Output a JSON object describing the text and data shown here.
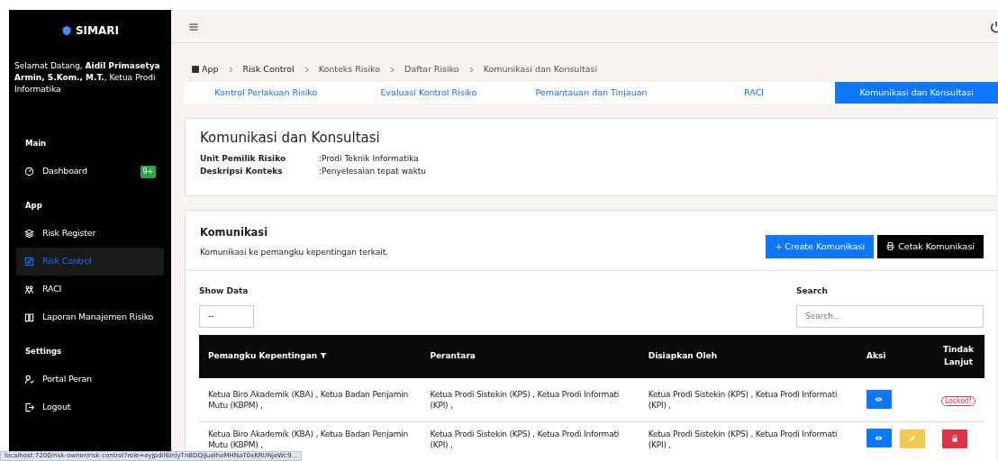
{
  "sidebar": {
    "brand": "SIMARI",
    "welcome": "Selamat Datang, **Aidil Primasetya Armin, S.Kom., M.T.**, Ketua Prodi Informatika",
    "sections": [
      {
        "title": "Main",
        "items": [
          {
            "label": "Dashboard",
            "selected": false,
            "badge": "9+"
          }
        ]
      },
      {
        "title": "App",
        "items": [
          {
            "label": "Risk Register",
            "selected": false
          },
          {
            "label": "Risk Control",
            "selected": true
          },
          {
            "label": "RACI",
            "selected": false
          },
          {
            "label": "Laporan Manajemen Risiko",
            "selected": false
          }
        ]
      },
      {
        "title": "Settings",
        "items": [
          {
            "label": "Portal Peran",
            "selected": false
          },
          {
            "label": "Logout",
            "selected": false
          }
        ]
      }
    ]
  },
  "breadcrumb": [
    {
      "label": "App"
    },
    {
      "label": "Risk Control"
    },
    {
      "label": "Konteks Risiko"
    },
    {
      "label": "Daftar Risiko"
    },
    {
      "label": "Komunikasi dan Konsultasi"
    }
  ],
  "tabs": [
    {
      "label": "Kontrol Perlakuan Risiko",
      "selected": false
    },
    {
      "label": "Evaluasi Kontrol Risiko",
      "selected": false
    },
    {
      "label": "Pemantauan dan Tinjauan",
      "selected": false
    },
    {
      "label": "RACI",
      "selected": false
    },
    {
      "label": "Komunikasi dan Konsultasi",
      "selected": true
    }
  ],
  "context": {
    "title": "Komunikasi dan Konsultasi",
    "fields": [
      {
        "label": "Unit Pemilik Risiko",
        "value": ":Prodi Teknik Informatika"
      },
      {
        "label": "Deskripsi Konteks",
        "value": ":Penyelesaian tepat waktu"
      }
    ]
  },
  "komunikasi": {
    "title": "Komunikasi",
    "subtitle": "Komunikasi ke pemangku kepentingan terkait.",
    "buttons": [
      {
        "label": "+ Create Komunikasi",
        "kind": "create"
      },
      {
        "label": "Cetak Komunikasi",
        "kind": "print"
      }
    ],
    "show_data": {
      "label": "Show Data",
      "value": "--"
    },
    "search": {
      "label": "Search",
      "placeholder": "Search..."
    },
    "columns": [
      "Pemangku Kepentingan",
      "Perantara",
      "Disiapkan Oleh",
      "Aksi",
      "Tindak Lanjut"
    ],
    "rows": [
      {
        "cells": [
          "Ketua Biro Akademik (KBA) , Ketua Badan Penjamin Mutu (KBPM) ,",
          "Ketua Prodi Sistekin (KPS) , Ketua Prodi Informati (KPI) ,",
          "Ketua Prodi Sistekin (KPS) , Ketua Prodi Informati (KPI) ,"
        ],
        "actions": [
          {
            "kind": "view"
          }
        ],
        "follow_up": {
          "kind": "badge",
          "text": "Locked!"
        }
      },
      {
        "cells": [
          "Ketua Biro Akademik (KBA) , Ketua Badan Penjamin Mutu (KBPM) ,",
          "Ketua Prodi Sistekin (KPS) , Ketua Prodi Informati (KPI) ,",
          "Ketua Prodi Sistekin (KPS) , Ketua Prodi Informati (KPI) ,"
        ],
        "actions": [
          {
            "kind": "view"
          },
          {
            "kind": "edit"
          }
        ],
        "follow_up": {
          "kind": "lock"
        }
      }
    ]
  },
  "status_bar": {
    "url": "localhost:7200/risk-owner/risk-control?role=eyJpdil6InlyTnBDQiJuelhoMHNaT0xKRUNjeWc9..."
  }
}
